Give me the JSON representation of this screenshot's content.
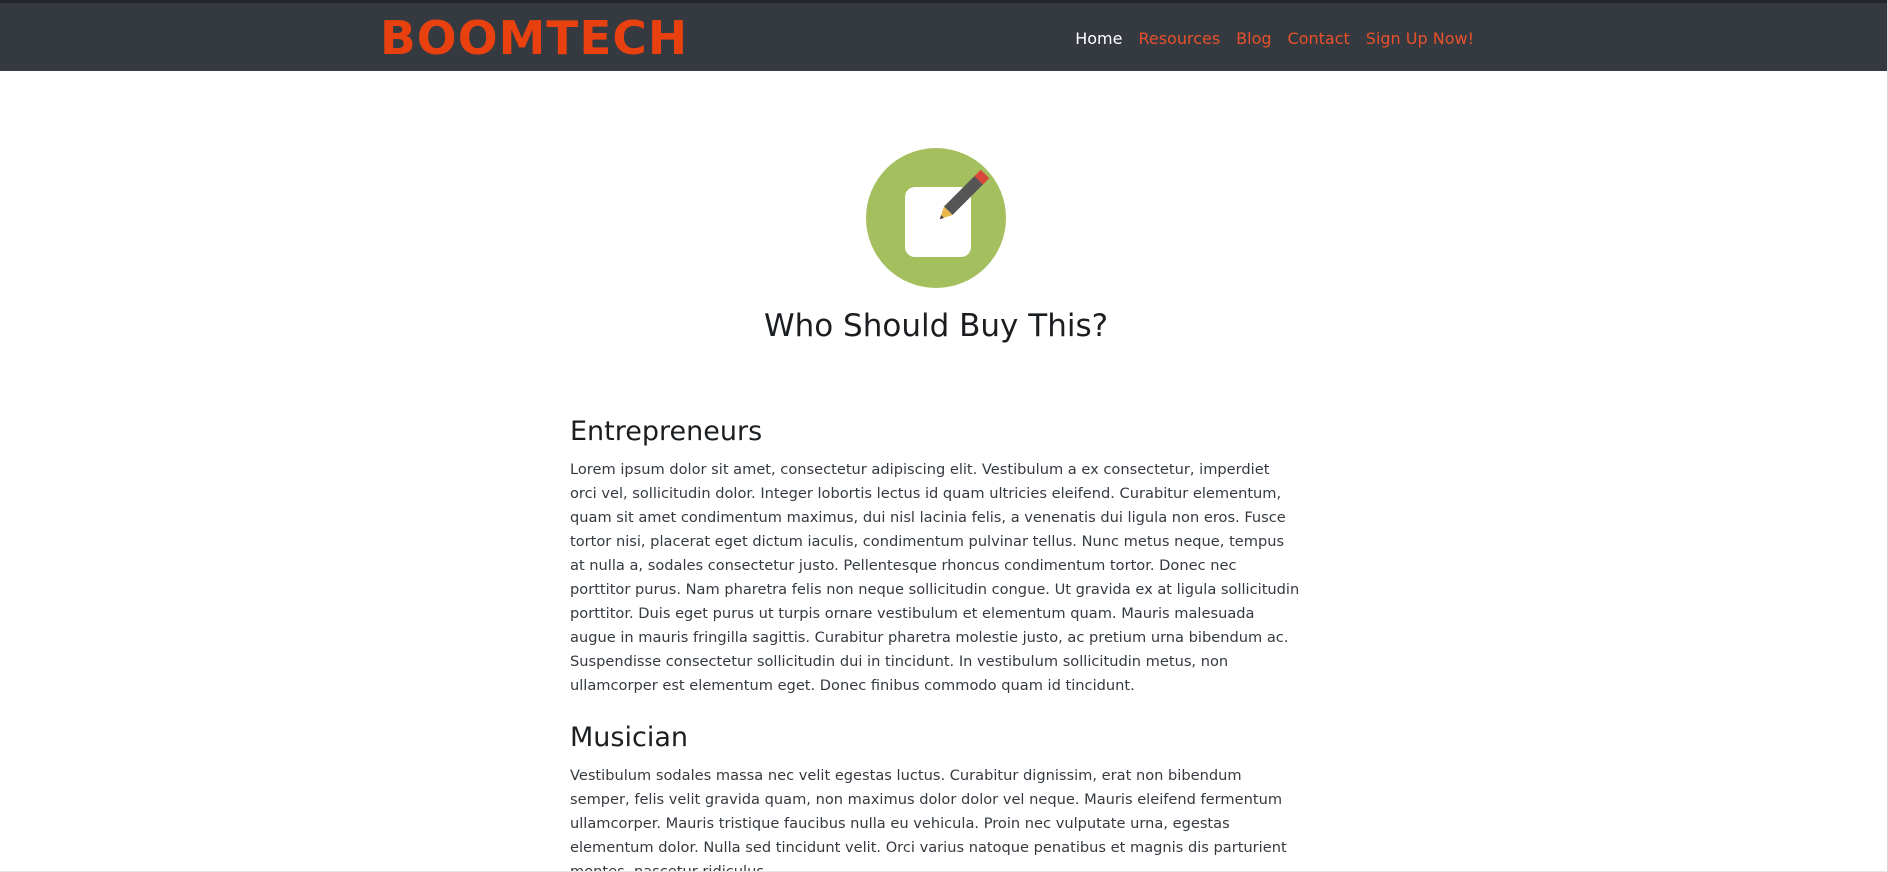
{
  "brand": {
    "name": "BOOMTECH",
    "color": "#e8410f"
  },
  "nav": {
    "items": [
      {
        "label": "Home",
        "active": true
      },
      {
        "label": "Resources",
        "active": false
      },
      {
        "label": "Blog",
        "active": false
      },
      {
        "label": "Contact",
        "active": false
      },
      {
        "label": "Sign Up Now!",
        "active": false
      }
    ]
  },
  "hero": {
    "icon": "edit-note-icon",
    "icon_bg": "#a4bf5e",
    "title": "Who Should Buy This?"
  },
  "sections": [
    {
      "title": "Entrepreneurs",
      "body": "Lorem ipsum dolor sit amet, consectetur adipiscing elit. Vestibulum a ex consectetur, imperdiet orci vel, sollicitudin dolor. Integer lobortis lectus id quam ultricies eleifend. Curabitur elementum, quam sit amet condimentum maximus, dui nisl lacinia felis, a venenatis dui ligula non eros. Fusce tortor nisi, placerat eget dictum iaculis, condimentum pulvinar tellus. Nunc metus neque, tempus at nulla a, sodales consectetur justo. Pellentesque rhoncus condimentum tortor. Donec nec porttitor purus. Nam pharetra felis non neque sollicitudin congue. Ut gravida ex at ligula sollicitudin porttitor. Duis eget purus ut turpis ornare vestibulum et elementum quam. Mauris malesuada augue in mauris fringilla sagittis. Curabitur pharetra molestie justo, ac pretium urna bibendum ac. Suspendisse consectetur sollicitudin dui in tincidunt. In vestibulum sollicitudin metus, non ullamcorper est elementum eget. Donec finibus commodo quam id tincidunt."
    },
    {
      "title": "Musician",
      "body": "Vestibulum sodales massa nec velit egestas luctus. Curabitur dignissim, erat non bibendum semper, felis velit gravida quam, non maximus dolor dolor vel neque. Mauris eleifend fermentum ullamcorper. Mauris tristique faucibus nulla eu vehicula. Proin nec vulputate urna, egestas elementum dolor. Nulla sed tincidunt velit. Orci varius natoque penatibus et magnis dis parturient montes, nascetur ridiculus"
    }
  ]
}
